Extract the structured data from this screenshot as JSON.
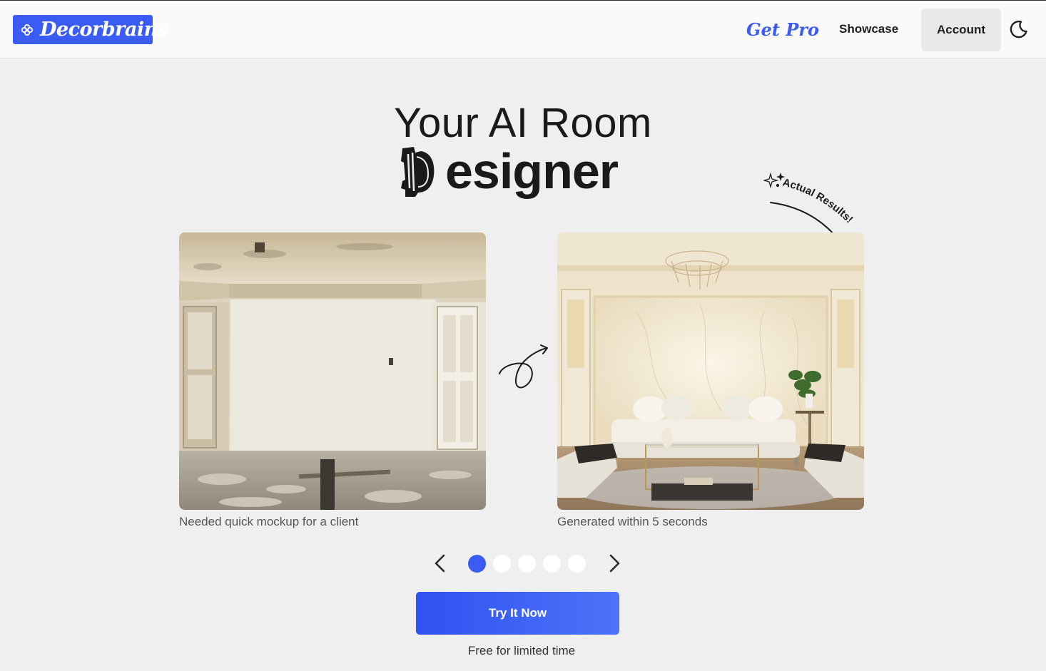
{
  "header": {
    "logo_text": "Decorbrains",
    "get_pro": "Get Pro",
    "showcase": "Showcase",
    "account": "Account",
    "theme_icon": "moon-icon"
  },
  "hero": {
    "title_line1": "Your AI Room",
    "title_line2_rest": "esigner",
    "badge": "Actual Results!"
  },
  "comparison": {
    "before_caption": "Needed quick mockup for a client",
    "after_caption": "Generated within 5 seconds"
  },
  "carousel": {
    "total_slides": 5,
    "active_slide": 1
  },
  "cta": {
    "button": "Try It Now",
    "subtext": "Free for limited time"
  },
  "colors": {
    "accent": "#3b5bf5",
    "background": "#efefef",
    "header": "#fafafa"
  }
}
